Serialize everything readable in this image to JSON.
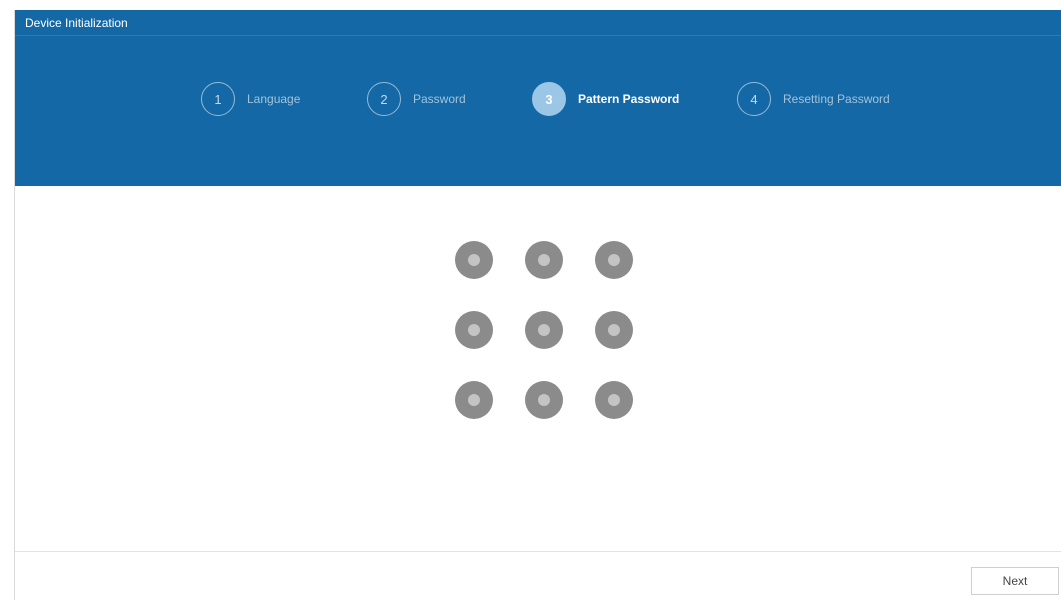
{
  "window": {
    "title": "Device Initialization"
  },
  "steps": [
    {
      "number": "1",
      "label": "Language",
      "active": false
    },
    {
      "number": "2",
      "label": "Password",
      "active": false
    },
    {
      "number": "3",
      "label": "Pattern Password",
      "active": true
    },
    {
      "number": "4",
      "label": "Resetting Password",
      "active": false
    }
  ],
  "footer": {
    "next_label": "Next"
  },
  "colors": {
    "header_blue": "#1468a5",
    "active_step": "#9bc6e6",
    "pattern_dot": "#8b8b8b",
    "pattern_dot_center": "#c4c4c4"
  }
}
